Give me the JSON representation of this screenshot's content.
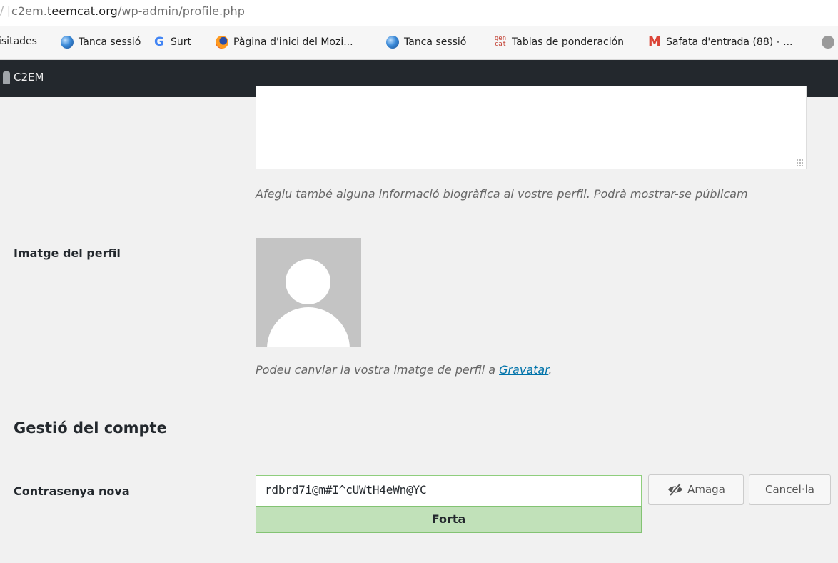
{
  "browser": {
    "url_prefix": "c2em.",
    "url_domain": "teemcat.org",
    "url_path": "/wp-admin/profile.php"
  },
  "bookmarks": [
    {
      "label": "isitades",
      "icon": "none"
    },
    {
      "label": "Tanca sessió",
      "icon": "globe-blue-icon"
    },
    {
      "label": "Surt",
      "icon": "google-icon"
    },
    {
      "label": "Pàgina d'inici del Mozi...",
      "icon": "firefox-icon"
    },
    {
      "label": "Tanca sessió",
      "icon": "globe-blue-icon"
    },
    {
      "label": "Tablas de ponderación",
      "icon": "gencat-icon"
    },
    {
      "label": "Safata d'entrada (88) - ...",
      "icon": "gmail-icon"
    }
  ],
  "adminbar": {
    "site_name": "C2EM"
  },
  "profile": {
    "bio_value": "",
    "bio_description": "Afegiu també alguna informació biogràfica al vostre perfil. Podrà mostrar-se públicam",
    "picture_label": "Imatge del perfil",
    "picture_desc_prefix": "Podeu canviar la vostra imatge de perfil a ",
    "picture_desc_link": "Gravatar",
    "picture_desc_suffix": "."
  },
  "account": {
    "section_title": "Gestió del compte",
    "new_password_label": "Contrasenya nova",
    "password_value": "rdbrd7i@m#I^cUWtH4eWn@YC",
    "strength_label": "Forta",
    "hide_button": "Amaga",
    "cancel_button": "Cancel·la"
  },
  "colors": {
    "adminbar_bg": "#23282d",
    "strength_bg": "#c1e1b9",
    "link": "#0073aa"
  }
}
